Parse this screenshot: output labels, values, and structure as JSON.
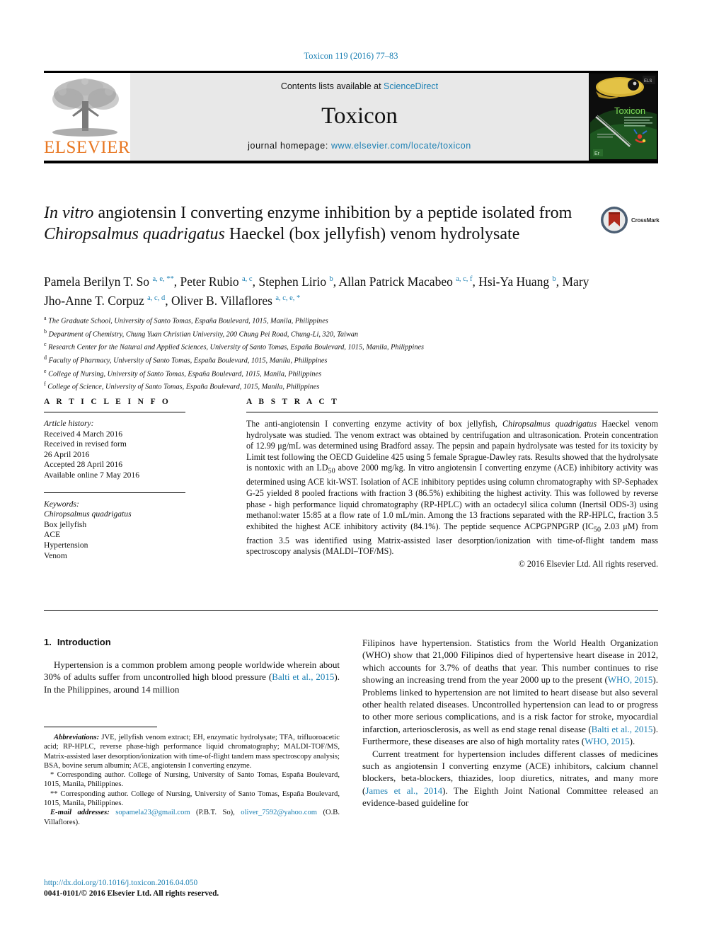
{
  "running_head": "Toxicon 119 (2016) 77–83",
  "masthead": {
    "publisher_logo_text": "ELSEVIER",
    "contents_prefix": "Contents lists available at ",
    "contents_link": "ScienceDirect",
    "journal_name": "Toxicon",
    "homepage_prefix": "journal homepage: ",
    "homepage_url": "www.elsevier.com/locate/toxicon",
    "cover_journal_name": "Toxicon"
  },
  "crossmark": {
    "label": "CrossMark"
  },
  "title": {
    "part1_italic": "In vitro",
    "part2": " angiotensin I converting enzyme inhibition by a peptide isolated from ",
    "part3_italic": "Chiropsalmus quadrigatus",
    "part4": " Haeckel (box jellyfish) venom hydrolysate"
  },
  "authors": [
    {
      "name": "Pamela Berilyn T. So",
      "sup": "a, e, **"
    },
    {
      "name": "Peter Rubio",
      "sup": "a, c"
    },
    {
      "name": "Stephen Lirio",
      "sup": "b"
    },
    {
      "name": "Allan Patrick Macabeo",
      "sup": "a, c, f"
    },
    {
      "name": "Hsi-Ya Huang",
      "sup": "b"
    },
    {
      "name": "Mary Jho-Anne T. Corpuz",
      "sup": "a, c, d"
    },
    {
      "name": "Oliver B. Villaflores",
      "sup": "a, c, e, *"
    }
  ],
  "affiliations": [
    {
      "mark": "a",
      "text": "The Graduate School, University of Santo Tomas, España Boulevard, 1015, Manila, Philippines"
    },
    {
      "mark": "b",
      "text": "Department of Chemistry, Chung Yuan Christian University, 200 Chung Pei Road, Chung-Li, 320, Taiwan"
    },
    {
      "mark": "c",
      "text": "Research Center for the Natural and Applied Sciences, University of Santo Tomas, España Boulevard, 1015, Manila, Philippines"
    },
    {
      "mark": "d",
      "text": "Faculty of Pharmacy, University of Santo Tomas, España Boulevard, 1015, Manila, Philippines"
    },
    {
      "mark": "e",
      "text": "College of Nursing, University of Santo Tomas, España Boulevard, 1015, Manila, Philippines"
    },
    {
      "mark": "f",
      "text": "College of Science, University of Santo Tomas, España Boulevard, 1015, Manila, Philippines"
    }
  ],
  "article_info": {
    "heading": "A R T I C L E  I N F O",
    "history_label": "Article history:",
    "history": [
      "Received 4 March 2016",
      "Received in revised form",
      "26 April 2016",
      "Accepted 28 April 2016",
      "Available online 7 May 2016"
    ],
    "keywords_label": "Keywords:",
    "keywords": [
      "Chiropsalmus quadrigatus",
      "Box jellyfish",
      "ACE",
      "Hypertension",
      "Venom"
    ],
    "keyword_italic_index": 0
  },
  "abstract": {
    "heading": "A B S T R A C T",
    "segments": [
      {
        "t": "The anti-angiotensin I converting enzyme activity of box jellyfish, ",
        "i": false
      },
      {
        "t": "Chiropsalmus quadrigatus",
        "i": true
      },
      {
        "t": " Haeckel venom hydrolysate was studied. The venom extract was obtained by centrifugation and ultrasonication. Protein concentration of 12.99 μg/mL was determined using Bradford assay. The pepsin and papain hydrolysate was tested for its toxicity by Limit test following the OECD Guideline 425 using 5 female Sprague-Dawley rats. Results showed that the hydrolysate is nontoxic with an LD",
        "i": false
      },
      {
        "t": "50",
        "sub": true
      },
      {
        "t": " above 2000 mg/kg. In vitro angiotensin I converting enzyme (ACE) inhibitory activity was determined using ACE kit-WST. Isolation of ACE inhibitory peptides using column chromatography with SP-Sephadex G-25 yielded 8 pooled fractions with fraction 3 (86.5%) exhibiting the highest activity. This was followed by reverse phase - high performance liquid chromatography (RP-HPLC) with an octadecyl silica column (Inertsil ODS-3) using methanol:water 15:85 at a flow rate of 1.0 mL/min. Among the 13 fractions separated with the RP-HPLC, fraction 3.5 exhibited the highest ACE inhibitory activity (84.1%). The peptide sequence ACPGPNPGRP (IC",
        "i": false
      },
      {
        "t": "50",
        "sub": true
      },
      {
        "t": " 2.03 μM) from fraction 3.5 was identified using Matrix-assisted laser desorption/ionization with time-of-flight tandem mass spectroscopy analysis (MALDI–TOF/MS).",
        "i": false
      }
    ],
    "copyright": "© 2016 Elsevier Ltd. All rights reserved."
  },
  "introduction": {
    "number": "1.",
    "heading": "Introduction",
    "left_paragraph": {
      "pre": "Hypertension is a common problem among people worldwide wherein about 30% of adults suffer from uncontrolled high blood pressure (",
      "ref": "Balti et al., 2015",
      "post": "). In the Philippines, around 14 million"
    },
    "right_paragraph_1": {
      "pre": "Filipinos have hypertension. Statistics from the World Health Organization (WHO) show that 21,000 Filipinos died of hypertensive heart disease in 2012, which accounts for 3.7% of deaths that year. This number continues to rise showing an increasing trend from the year 2000 up to the present (",
      "ref": "WHO, 2015",
      "mid": "). Problems linked to hypertension are not limited to heart disease but also several other health related diseases. Uncontrolled hypertension can lead to or progress to other more serious complications, and is a risk factor for stroke, myocardial infarction, arteriosclerosis, as well as end stage renal disease (",
      "ref2": "Balti et al., 2015",
      "mid2": "). Furthermore, these diseases are also of high mortality rates (",
      "ref3": "WHO, 2015",
      "post": ")."
    },
    "right_paragraph_2": {
      "pre": "Current treatment for hypertension includes different classes of medicines such as angiotensin I converting enzyme (ACE) inhibitors, calcium channel blockers, beta-blockers, thiazides, loop diuretics, nitrates, and many more (",
      "ref": "James et al., 2014",
      "post": "). The Eighth Joint National Committee released an evidence-based guideline for"
    }
  },
  "footnotes": {
    "abbreviations_label": "Abbreviations:",
    "abbreviations_text": " JVE, jellyfish venom extract; EH, enzymatic hydrolysate; TFA, trifluoroacetic acid; RP-HPLC, reverse phase-high performance liquid chromatography; MALDI-TOF/MS, Matrix-assisted laser desorption/ionization with time-of-flight tandem mass spectroscopy analysis; BSA, bovine serum albumin; ACE, angiotensin I converting enzyme.",
    "corresponding_1": "* Corresponding author. College of Nursing, University of Santo Tomas, España Boulevard, 1015, Manila, Philippines.",
    "corresponding_2": "** Corresponding author. College of Nursing, University of Santo Tomas, España Boulevard, 1015, Manila, Philippines.",
    "email_label": "E-mail addresses:",
    "email_1": "sopamela23@gmail.com",
    "email_1_owner": " (P.B.T. So), ",
    "email_2": "oliver_7592@yahoo.com",
    "email_2_owner": " (O.B. Villaflores)."
  },
  "footer": {
    "doi": "http://dx.doi.org/10.1016/j.toxicon.2016.04.050",
    "issn_line": "0041-0101/© 2016 Elsevier Ltd. All rights reserved."
  },
  "colors": {
    "link": "#1a7fb3",
    "elsevier_orange": "#E87722",
    "band_gray": "#e8e8e8"
  }
}
